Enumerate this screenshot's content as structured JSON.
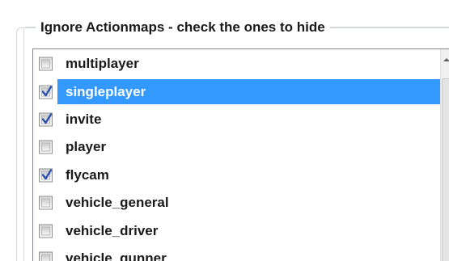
{
  "groupbox": {
    "title": "Ignore Actionmaps - check the ones to hide"
  },
  "actionmaps": [
    {
      "label": "multiplayer",
      "checked": false,
      "selected": false
    },
    {
      "label": "singleplayer",
      "checked": true,
      "selected": true
    },
    {
      "label": "invite",
      "checked": true,
      "selected": false
    },
    {
      "label": "player",
      "checked": false,
      "selected": false
    },
    {
      "label": "flycam",
      "checked": true,
      "selected": false
    },
    {
      "label": "vehicle_general",
      "checked": false,
      "selected": false
    },
    {
      "label": "vehicle_driver",
      "checked": false,
      "selected": false
    },
    {
      "label": "vehicle_gunner",
      "checked": false,
      "selected": false
    }
  ],
  "colors": {
    "selection": "#3399ff",
    "checkmark": "#2a4fb0"
  },
  "icons": {
    "checkmark": "checkmark-icon",
    "scroll_up": "chevron-up-icon"
  }
}
